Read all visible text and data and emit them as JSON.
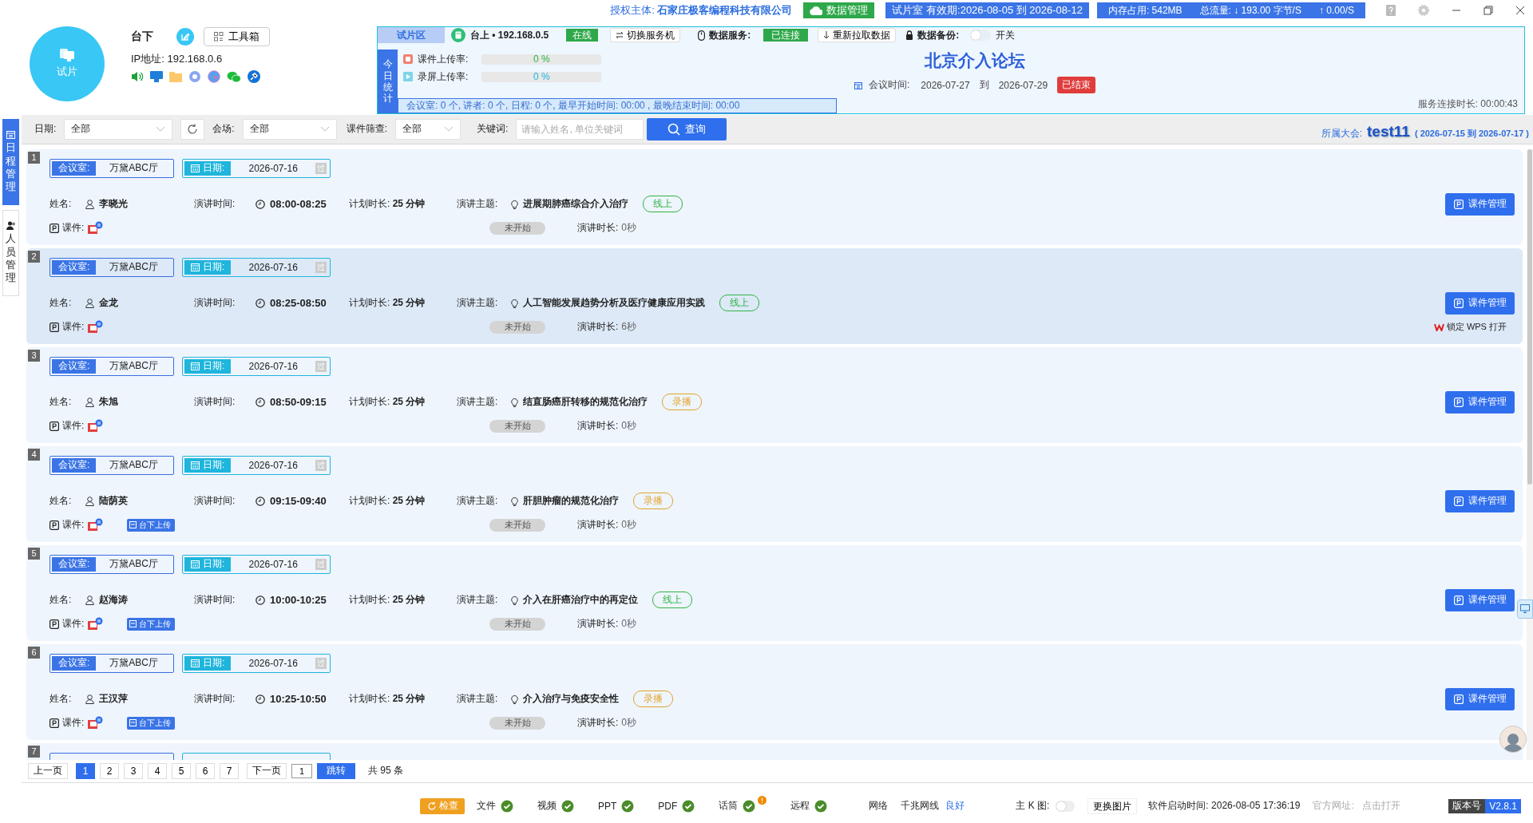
{
  "title_bar": {
    "license": "授权主体: **石家庄极客编程科技有限公司**",
    "data_button": "数据管理",
    "license_period": "试片室 有效期:2026-08-05 到 2026-08-12",
    "memory": "内存占用: 542MB",
    "traffic_down": "总流量: ↓ 193.00 字节/S",
    "traffic_up": "↑ 0.00/S"
  },
  "profile": {
    "avatar_label": "试片",
    "name": "台下",
    "toolbox_button": "工具箱",
    "ip": "IP地址: 192.168.0.6"
  },
  "server_panel": {
    "zone_tab": "试片区",
    "server": "台上 • 192.168.0.5",
    "server_status": "在线",
    "switch_button": "切换服务机",
    "data_service_label": "数据服务:",
    "data_service_status": "已连接",
    "reload_button": "重新拉取数据",
    "backup_label": "数据备份:",
    "backup": {
      "on": false,
      "label": "开关"
    }
  },
  "today_stats": {
    "title": "今日统计",
    "rates": [
      {
        "kind": "courseware",
        "label": "课件上传率:",
        "level": 0,
        "reading": "0 %"
      },
      {
        "kind": "recording",
        "label": "录屏上传率:",
        "level": 0,
        "reading": "0 %"
      }
    ],
    "summary": "会议室: 0 个, 讲者: 0 个, 日程: 0 个, 最早开始时间: 00:00 , 最晚结束时间: 00:00"
  },
  "conference": {
    "title": "北京介入论坛",
    "time_label": "会议时间:",
    "start": "2026-07-27",
    "to": "到",
    "end": "2026-07-29",
    "status": "已结束",
    "uptime": "服务连接时长: 00:00:43"
  },
  "side_tabs": [
    {
      "label": "日程管理",
      "selected": true
    },
    {
      "label": "人员管理",
      "selected": false
    }
  ],
  "filters": {
    "date_label": "日期:",
    "date_value": "全部",
    "venue_label": "会场:",
    "venue_value": "全部",
    "courseware_label": "课件筛查:",
    "courseware_value": "全部",
    "keyword_label": "关键词:",
    "keyword_placeholder": "请输入姓名, 单位关键词",
    "search_button": "查询",
    "conference_label": "所属大会:",
    "conference_name": "test11",
    "conference_range": "( 2026-07-15 到 2026-07-17 )"
  },
  "sessions": [
    {
      "kind": "full",
      "index": "1",
      "selected": false,
      "room_label": "会议室:",
      "room": "万黛ABC厅",
      "date_label": "日期:",
      "date": "2026-07-16",
      "past_mark": "过",
      "name_label": "姓名:",
      "name": "李晓光",
      "time_label": "演讲时间:",
      "time": "08:00-08:25",
      "planned": "计划时长: **25 分钟**",
      "topic_label": "演讲主题:",
      "topic": "进展期肺癌综合介入治疗",
      "mode": {
        "kind": "online",
        "label": "线上"
      },
      "courseware_label": "课件:",
      "status": "未开始",
      "speak_label": "演讲时长:",
      "speak": "0秒",
      "manage_button": "课件管理"
    },
    {
      "kind": "full",
      "index": "2",
      "selected": true,
      "room_label": "会议室:",
      "room": "万黛ABC厅",
      "date_label": "日期:",
      "date": "2026-07-16",
      "past_mark": "过",
      "name_label": "姓名:",
      "name": "金龙",
      "time_label": "演讲时间:",
      "time": "08:25-08:50",
      "planned": "计划时长: **25 分钟**",
      "topic_label": "演讲主题:",
      "topic": "人工智能发展趋势分析及医疗健康应用实践",
      "mode": {
        "kind": "online",
        "label": "线上"
      },
      "courseware_label": "课件:",
      "status": "未开始",
      "speak_label": "演讲时长:",
      "speak": "6秒",
      "manage_button": "课件管理",
      "note": "锁定 WPS 打开"
    },
    {
      "kind": "full",
      "index": "3",
      "selected": false,
      "room_label": "会议室:",
      "room": "万黛ABC厅",
      "date_label": "日期:",
      "date": "2026-07-16",
      "past_mark": "过",
      "name_label": "姓名:",
      "name": "朱旭",
      "time_label": "演讲时间:",
      "time": "08:50-09:15",
      "planned": "计划时长: **25 分钟**",
      "topic_label": "演讲主题:",
      "topic": "结直肠癌肝转移的规范化治疗",
      "mode": {
        "kind": "recorded",
        "label": "录播"
      },
      "courseware_label": "课件:",
      "status": "未开始",
      "speak_label": "演讲时长:",
      "speak": "0秒",
      "manage_button": "课件管理"
    },
    {
      "kind": "full",
      "index": "4",
      "selected": false,
      "room_label": "会议室:",
      "room": "万黛ABC厅",
      "date_label": "日期:",
      "date": "2026-07-16",
      "past_mark": "过",
      "name_label": "姓名:",
      "name": "陆荫英",
      "time_label": "演讲时间:",
      "time": "09:15-09:40",
      "planned": "计划时长: **25 分钟**",
      "topic_label": "演讲主题:",
      "topic": "肝胆肿瘤的规范化治疗",
      "mode": {
        "kind": "recorded",
        "label": "录播"
      },
      "courseware_label": "课件:",
      "upload_tag": "台下上传",
      "status": "未开始",
      "speak_label": "演讲时长:",
      "speak": "0秒",
      "manage_button": "课件管理"
    },
    {
      "kind": "full",
      "index": "5",
      "selected": false,
      "room_label": "会议室:",
      "room": "万黛ABC厅",
      "date_label": "日期:",
      "date": "2026-07-16",
      "past_mark": "过",
      "name_label": "姓名:",
      "name": "赵海涛",
      "time_label": "演讲时间:",
      "time": "10:00-10:25",
      "planned": "计划时长: **25 分钟**",
      "topic_label": "演讲主题:",
      "topic": "介入在肝癌治疗中的再定位",
      "mode": {
        "kind": "online",
        "label": "线上"
      },
      "courseware_label": "课件:",
      "upload_tag": "台下上传",
      "status": "未开始",
      "speak_label": "演讲时长:",
      "speak": "0秒",
      "manage_button": "课件管理"
    },
    {
      "kind": "full",
      "index": "6",
      "selected": false,
      "room_label": "会议室:",
      "room": "万黛ABC厅",
      "date_label": "日期:",
      "date": "2026-07-16",
      "past_mark": "过",
      "name_label": "姓名:",
      "name": "王汉萍",
      "time_label": "演讲时间:",
      "time": "10:25-10:50",
      "planned": "计划时长: **25 分钟**",
      "topic_label": "演讲主题:",
      "topic": "介入治疗与免疫安全性",
      "mode": {
        "kind": "recorded",
        "label": "录播"
      },
      "courseware_label": "课件:",
      "upload_tag": "台下上传",
      "status": "未开始",
      "speak_label": "演讲时长:",
      "speak": "0秒",
      "manage_button": "课件管理"
    },
    {
      "kind": "partial",
      "index": "7",
      "selected": false
    }
  ],
  "pagination": {
    "prev": "上一页",
    "pages": [
      {
        "label": "1",
        "selected": true
      },
      {
        "label": "2",
        "selected": false
      },
      {
        "label": "3",
        "selected": false
      },
      {
        "label": "4",
        "selected": false
      },
      {
        "label": "5",
        "selected": false
      },
      {
        "label": "6",
        "selected": false
      },
      {
        "label": "7",
        "selected": false
      }
    ],
    "next": "下一页",
    "jump_value": "1",
    "jump_button": "跳转",
    "total": "共 95 条"
  },
  "status_bar": {
    "check_button": "检查",
    "checks": [
      {
        "label": "文件",
        "ok": true,
        "warning": false
      },
      {
        "label": "视频",
        "ok": true,
        "warning": false
      },
      {
        "label": "PPT",
        "ok": true,
        "warning": false
      },
      {
        "label": "PDF",
        "ok": true,
        "warning": false
      },
      {
        "label": "话筒",
        "ok": true,
        "warning": true
      },
      {
        "label": "远程",
        "ok": true,
        "warning": false
      }
    ],
    "network_label": "网络",
    "network_type": "千兆网线",
    "network_quality": "良好",
    "k_label": "主 K 图:",
    "k_toggle": {
      "on": false
    },
    "change_image_button": "更换图片",
    "start_time": "软件启动时间: 2026-08-05 17:36:19",
    "site_label": "官方网址:",
    "site_link": "点击打开",
    "version_label": "版本号",
    "version": "V2.8.1"
  }
}
